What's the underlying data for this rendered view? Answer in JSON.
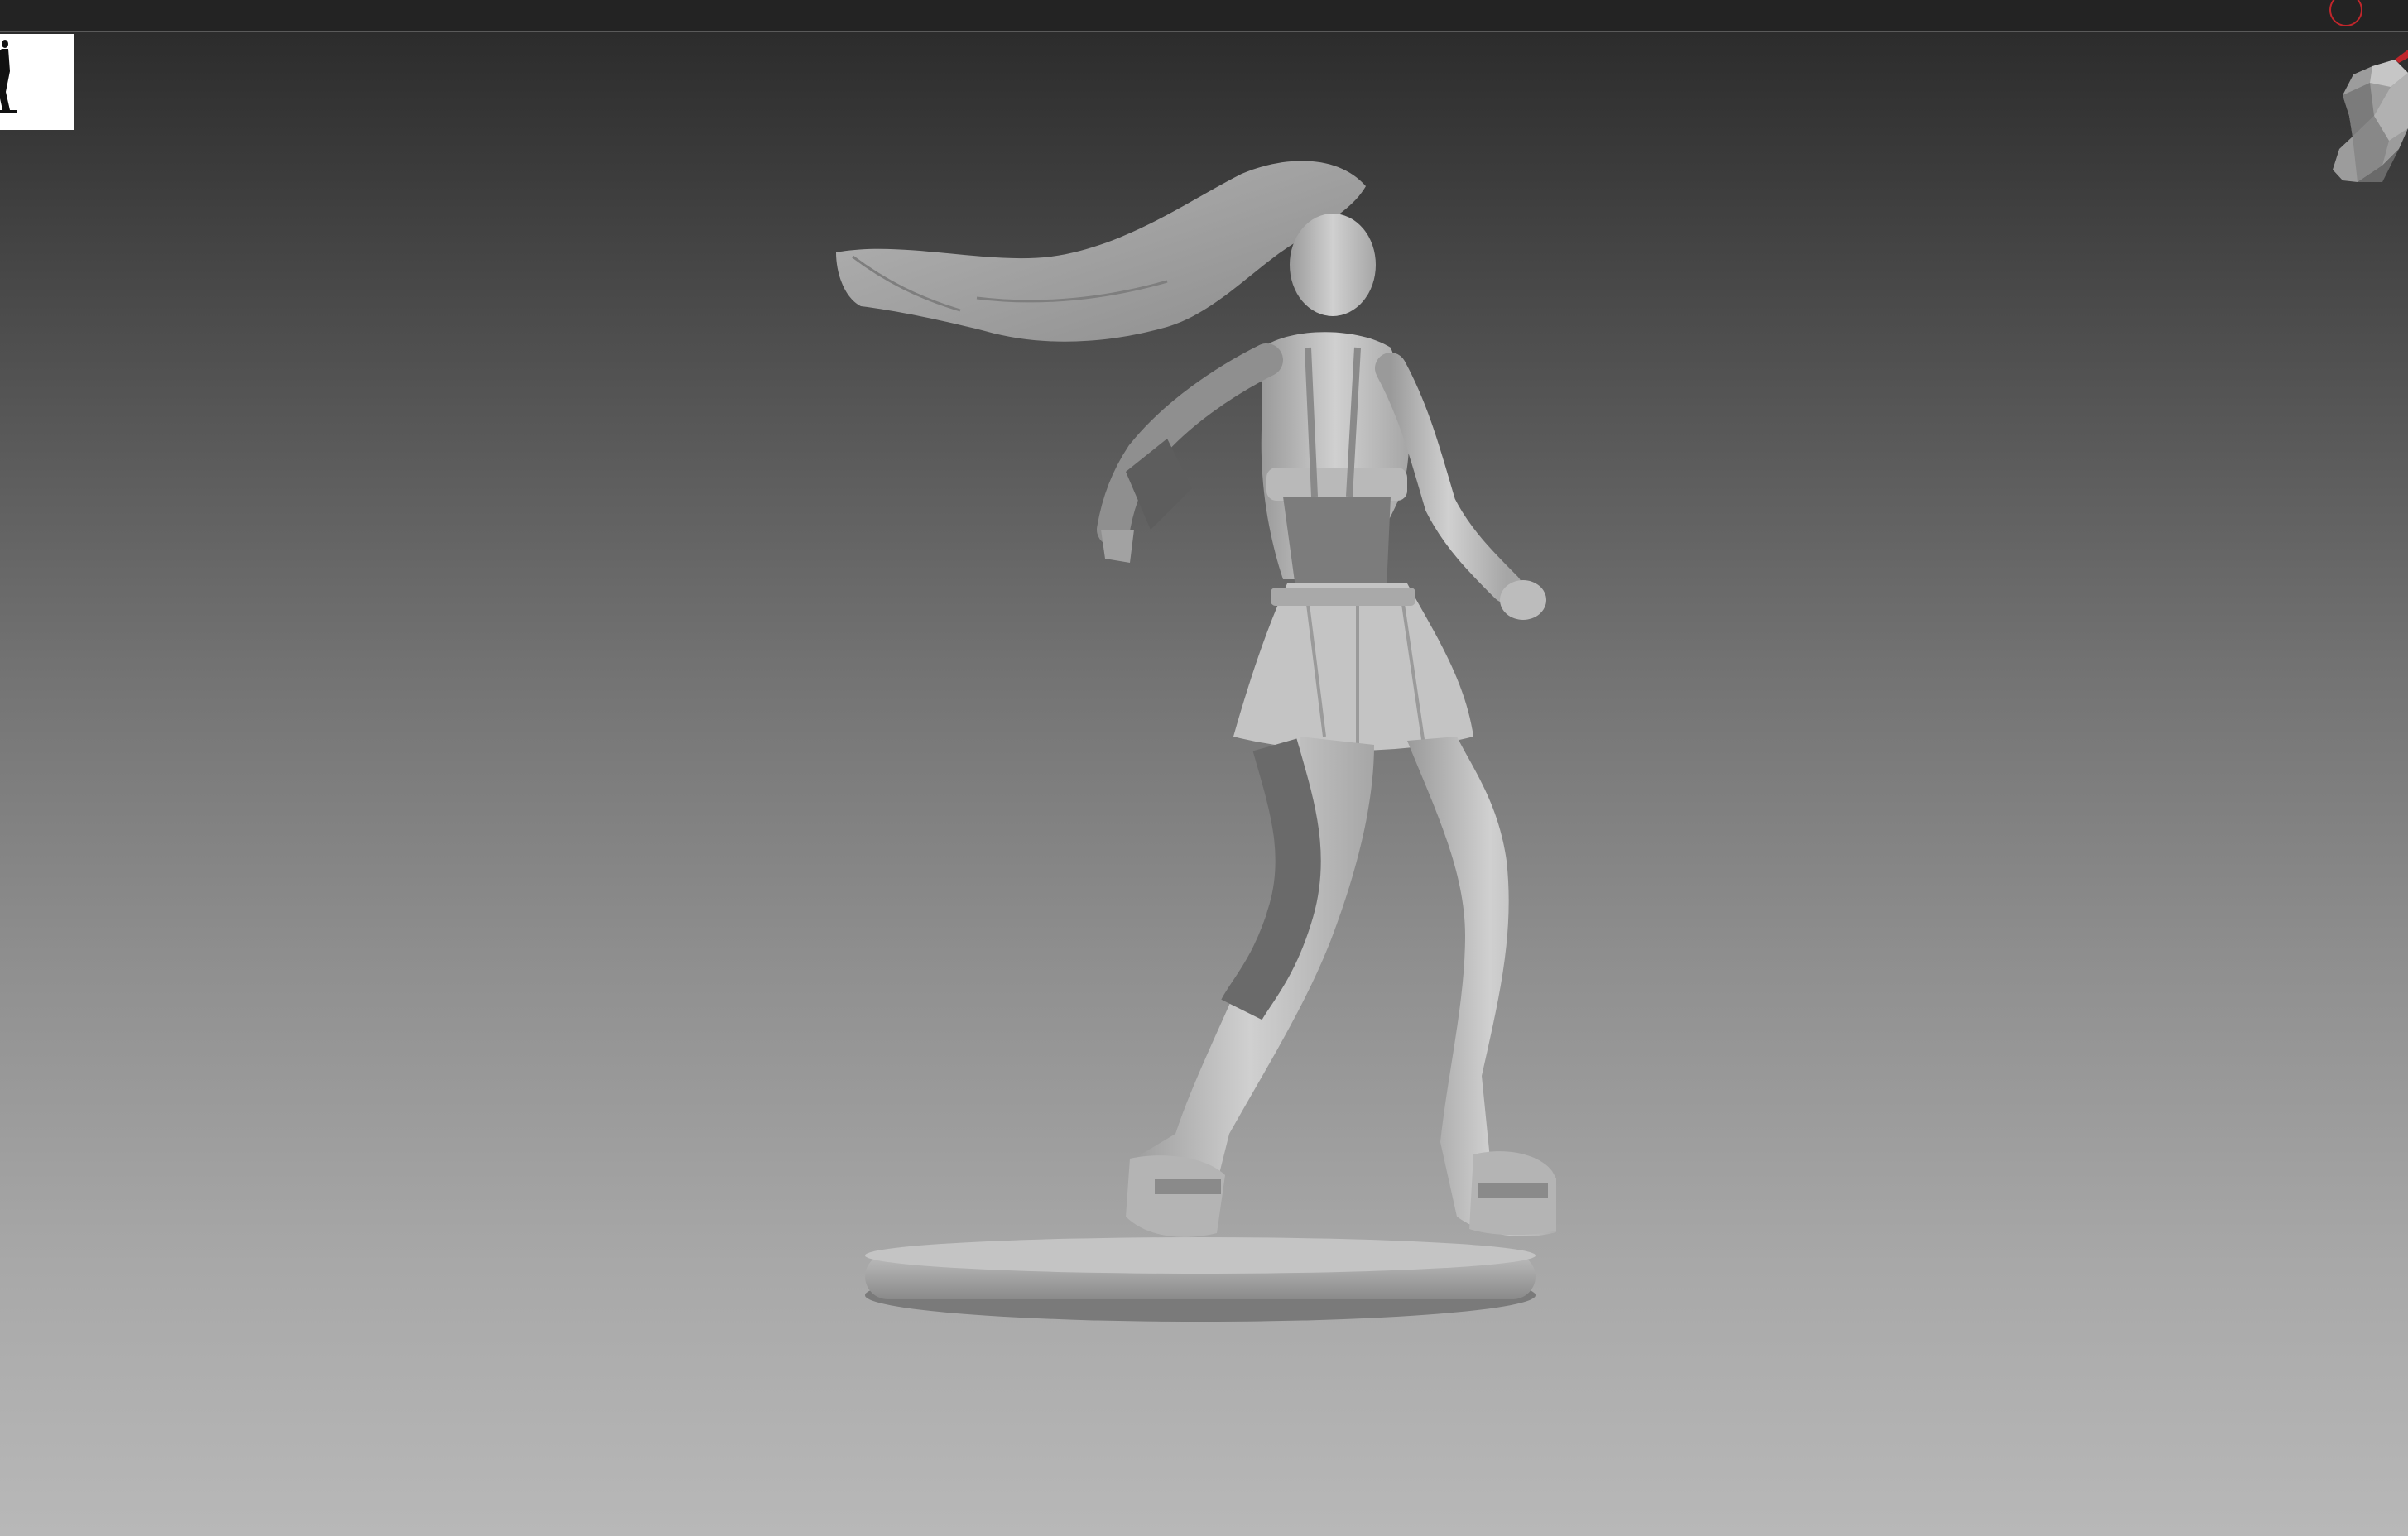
{
  "app": {
    "title": ""
  },
  "viewport": {
    "background_top": "#2c2c2c",
    "background_bottom": "#b8b8b8",
    "model_color": "#c8c8c8",
    "shadow_color": "#6e6e6e"
  },
  "icons": {
    "thumbnail": "model-thumbnail-icon",
    "record": "record-circle-icon",
    "navigation": "head-navigation-cube-icon"
  },
  "accent": {
    "record_red": "#c0262b"
  }
}
